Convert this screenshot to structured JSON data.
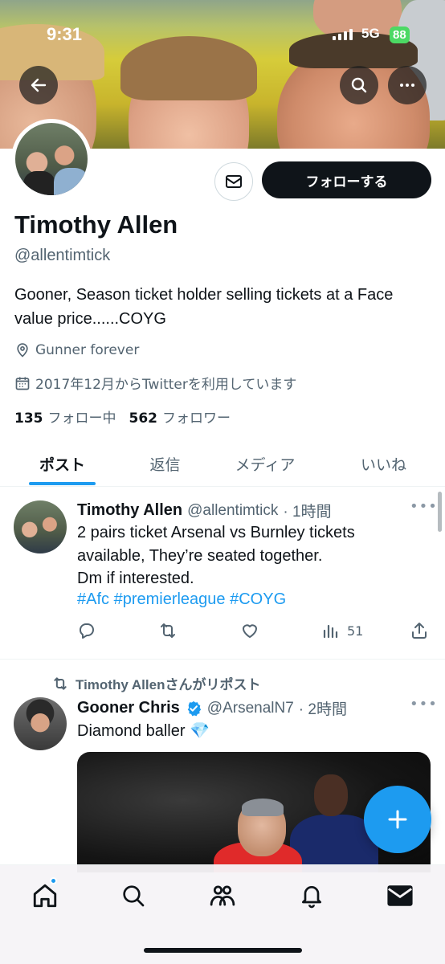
{
  "status_bar": {
    "time": "9:31",
    "network": "5G",
    "battery": "88"
  },
  "header": {
    "follow_label": "フォローする"
  },
  "profile": {
    "name": "Timothy Allen",
    "handle": "@allentimtick",
    "bio": "Gooner, Season ticket holder selling tickets at a Face value price......COYG",
    "location": "Gunner forever",
    "joined": "2017年12月からTwitterを利用しています",
    "following_count": "135",
    "following_label": "フォロー中",
    "followers_count": "562",
    "followers_label": "フォロワー"
  },
  "tabs": [
    {
      "label": "ポスト",
      "active": true
    },
    {
      "label": "返信"
    },
    {
      "label": "メディア"
    },
    {
      "label": "いいね"
    }
  ],
  "tweets": [
    {
      "name": "Timothy Allen",
      "handle": "@allentimtick",
      "time": "· 1時間",
      "text": "2 pairs ticket Arsenal vs Burnley tickets\navailable, They’re seated together.\n Dm if interested.",
      "hashtags": "#Afc #premierleague #COYG",
      "views": "51"
    },
    {
      "repost_label": "Timothy Allenさんがリポスト",
      "name": "Gooner Chris",
      "handle": "@ArsenalN7",
      "time": "· 2時間",
      "text": "Diamond baller 💎"
    }
  ],
  "colors": {
    "accent": "#1d9bf0",
    "text": "#0f1419",
    "secondary": "#536471"
  },
  "icons": [
    "back-arrow-icon",
    "search-icon",
    "more-icon",
    "mail-icon",
    "location-icon",
    "calendar-icon",
    "reply-icon",
    "repost-icon",
    "like-icon",
    "views-icon",
    "share-icon",
    "verified-icon",
    "compose-plus-icon",
    "home-icon",
    "explore-icon",
    "communities-icon",
    "notifications-icon",
    "messages-icon"
  ]
}
